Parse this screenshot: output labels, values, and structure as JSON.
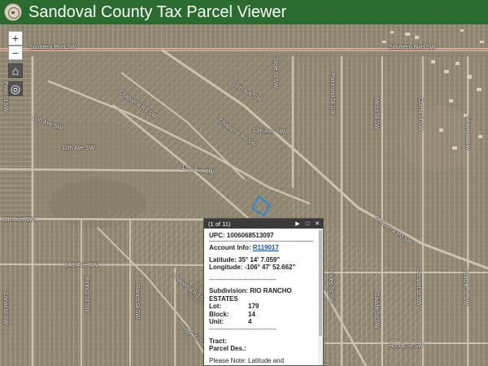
{
  "header": {
    "title": "Sandoval County Tax Parcel Viewer"
  },
  "controls": {
    "zoom_in": "+",
    "zoom_out": "−",
    "home": "⌂",
    "locate": "◎"
  },
  "streets": {
    "southern_blvd_left": "Southern Blvd SW",
    "southern_blvd_right": "Southern Blvd SW",
    "ave_16th": "16th Ave SW",
    "ave_13th": "13th Ave SW",
    "ave_12th_left": "12th Ave SW",
    "ave_12th_right": "12th Ave SW",
    "ave_11th": "11th Ave SW",
    "ave_14th": "14th Ave SW",
    "ave_13th_left": "13th Ave SW",
    "chaparral_1": "Chaparral Rd SW",
    "chaparral_2": "Chaparral Rd SW",
    "chaparral_3": "Chaparral Rd SW",
    "chaparral_4": "Chaparral Rd SW",
    "st_v1": "Sage St SW",
    "st_v2": "Palomino St SW",
    "st_v3": "Mesa St SW",
    "st_v4": "Corral St SW",
    "st_v5": "Arroyo St SW",
    "st_v6": "Pinto St SW",
    "st_v7": "Lariat St SW",
    "st_v8": "Bronco St SW",
    "st_v9": "Ranch St SW",
    "st_v10": "Rodeo St SW",
    "st_v11": "Saddle St SW",
    "st_v12": "Canyon St SW",
    "st_v13": "Apache St SW",
    "st_v14": "Ridge St SW",
    "st_v15": "Hondo St SW"
  },
  "popup": {
    "count": "(1 of 11)",
    "upc": "UPC: 1006068513097",
    "account_label": "Account Info:",
    "account_value": "R119017",
    "latitude": "Latitude: 35° 14' 7.059\"",
    "longitude": "Longitude: -106° 47' 52.662\"",
    "dashes1": "-------------------------------",
    "subdivision": "Subdivision: RIO RANCHO ESTATES",
    "lot_label": "Lot:",
    "lot_value": "179",
    "block_label": "Block:",
    "block_value": "14",
    "unit_label": "Unit:",
    "unit_value": "4",
    "dashes2": "-------------------------------",
    "tract": "Tract:",
    "parcel_des": "Parcel Des.:",
    "note": "Please Note: Latitude and Longitude is the approximate center of the parcel shown."
  },
  "colors": {
    "header": "#2c6b2f",
    "road": "#c9c1ad",
    "parcel_line": "#ffffff",
    "highlight": "#2f86d6",
    "southern_blvd": "#c84a3a"
  }
}
